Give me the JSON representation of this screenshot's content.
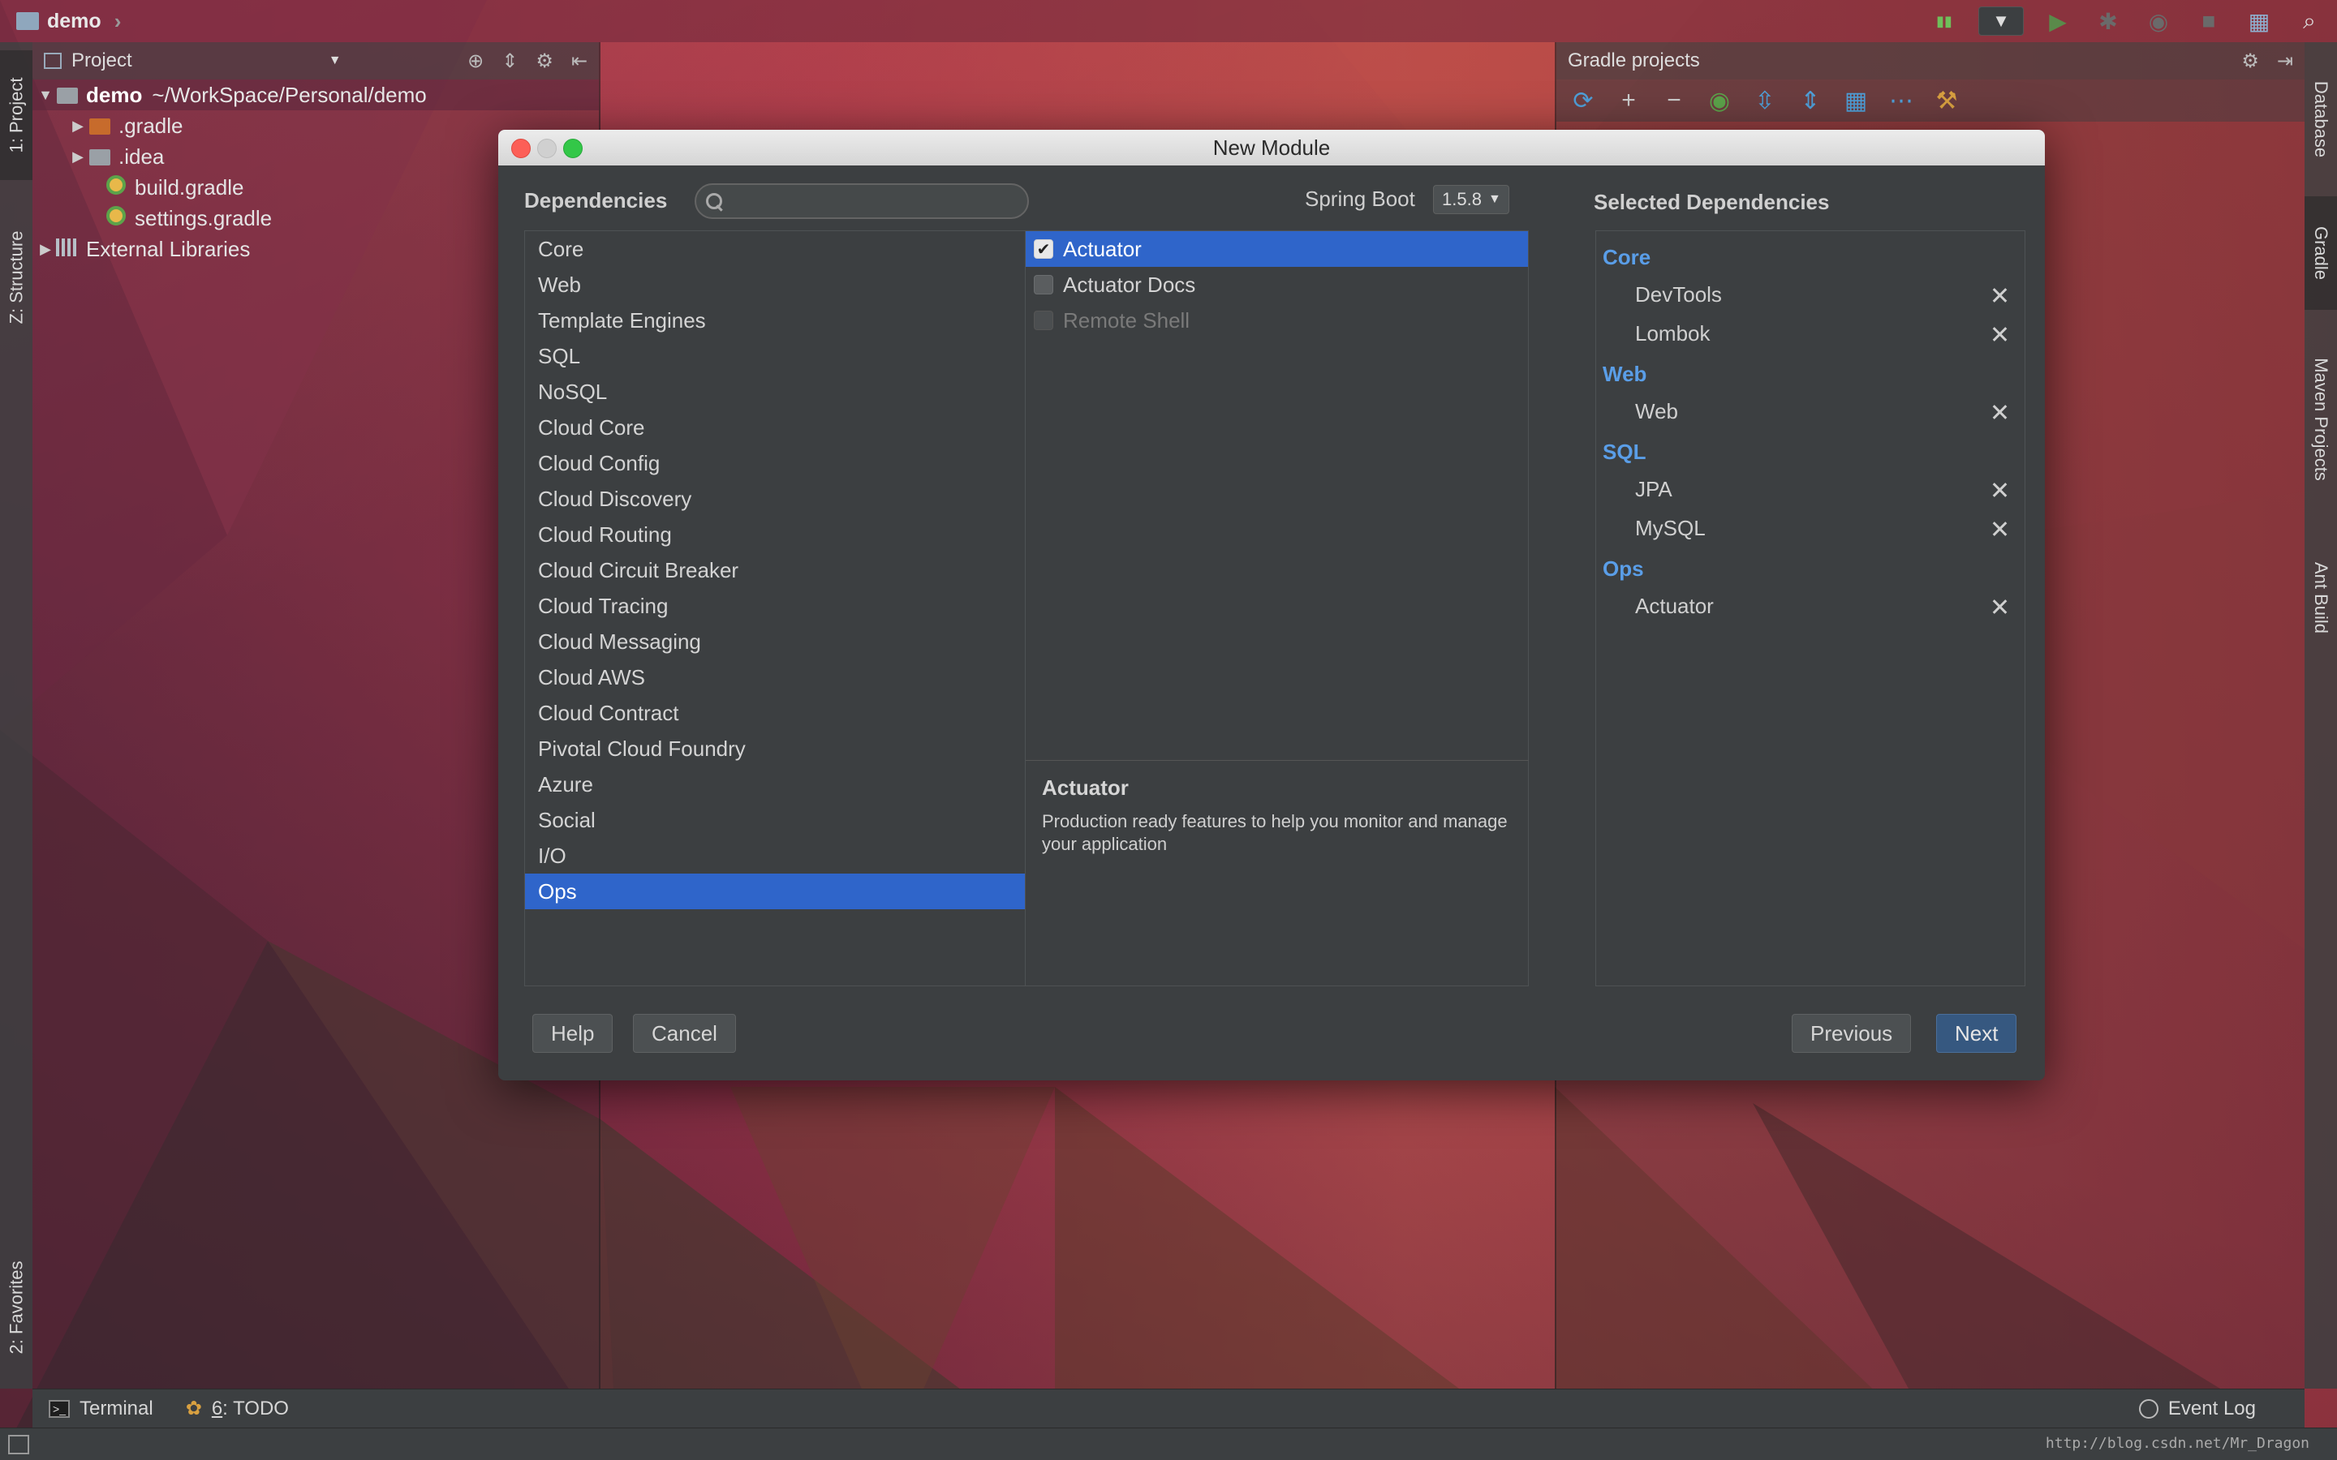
{
  "navbar": {
    "project_name": "demo"
  },
  "left_strip": {
    "project_tab": "1: Project",
    "structure_tab": "Z: Structure",
    "favorites_tab": "2: Favorites"
  },
  "right_strip": {
    "database_tab": "Database",
    "gradle_tab": "Gradle",
    "maven_tab": "Maven Projects",
    "ant_tab": "Ant Build"
  },
  "project_panel": {
    "title": "Project",
    "tree": [
      {
        "label": "demo",
        "path": "~/WorkSpace/Personal/demo"
      },
      {
        "label": ".gradle"
      },
      {
        "label": ".idea"
      },
      {
        "label": "build.gradle"
      },
      {
        "label": "settings.gradle"
      },
      {
        "label": "External Libraries"
      }
    ]
  },
  "gradle_panel": {
    "title": "Gradle projects"
  },
  "dialog": {
    "title": "New Module",
    "dependencies_label": "Dependencies",
    "search_placeholder": "",
    "spring_boot_label": "Spring Boot",
    "spring_boot_version": "1.5.8",
    "categories": [
      "Core",
      "Web",
      "Template Engines",
      "SQL",
      "NoSQL",
      "Cloud Core",
      "Cloud Config",
      "Cloud Discovery",
      "Cloud Routing",
      "Cloud Circuit Breaker",
      "Cloud Tracing",
      "Cloud Messaging",
      "Cloud AWS",
      "Cloud Contract",
      "Pivotal Cloud Foundry",
      "Azure",
      "Social",
      "I/O",
      "Ops"
    ],
    "selected_category": "Ops",
    "deps": [
      {
        "label": "Actuator",
        "checked": true
      },
      {
        "label": "Actuator Docs",
        "checked": false
      },
      {
        "label": "Remote Shell",
        "checked": false
      }
    ],
    "description": {
      "title": "Actuator",
      "body": "Production ready features to help you monitor and manage your application"
    },
    "selected_label": "Selected Dependencies",
    "selected": [
      {
        "group": "Core",
        "items": [
          "DevTools",
          "Lombok"
        ]
      },
      {
        "group": "Web",
        "items": [
          "Web"
        ]
      },
      {
        "group": "SQL",
        "items": [
          "JPA",
          "MySQL"
        ]
      },
      {
        "group": "Ops",
        "items": [
          "Actuator"
        ]
      }
    ],
    "buttons": {
      "help": "Help",
      "cancel": "Cancel",
      "previous": "Previous",
      "next": "Next"
    }
  },
  "bottom": {
    "terminal": "Terminal",
    "todo_num": "6",
    "todo_text": ": TODO",
    "event_log": "Event Log"
  },
  "status": {
    "watermark": "http://blog.csdn.net/Mr_Dragon"
  },
  "colors": {
    "accent": "#2f65ca",
    "group_blue": "#5a9ee8",
    "dialog_bg": "#3c3f41"
  }
}
